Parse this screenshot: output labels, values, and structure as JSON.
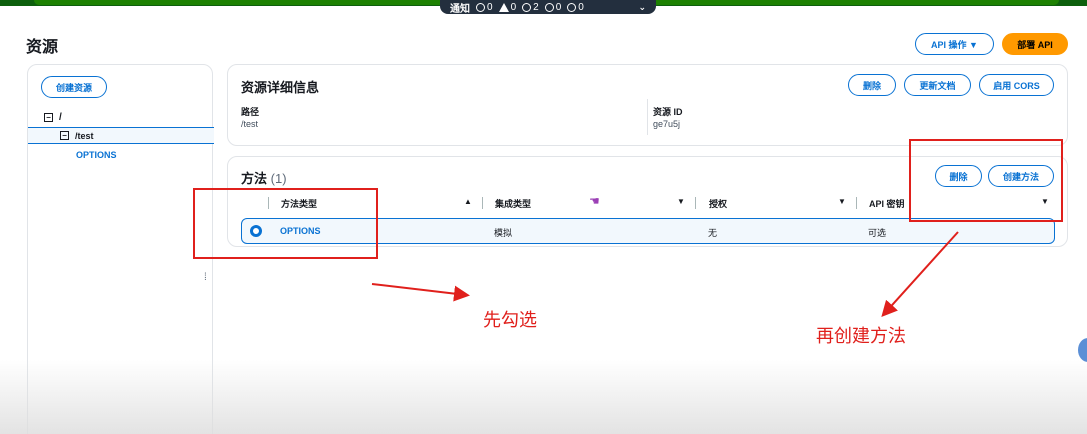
{
  "notifications": {
    "label": "通知",
    "counts": [
      "0",
      "0",
      "2",
      "0",
      "0"
    ],
    "expand_icon": "chevron-down-icon"
  },
  "header": {
    "title": "资源",
    "api_actions_label": "API 操作 ▼",
    "deploy_api_label": "部署 API"
  },
  "sidebar": {
    "create_resource_label": "创建资源",
    "tree": {
      "root": "/",
      "child": "/test",
      "method": "OPTIONS"
    }
  },
  "details": {
    "title": "资源详细信息",
    "delete_label": "删除",
    "update_doc_label": "更新文档",
    "enable_cors_label": "启用 CORS",
    "path_label": "路径",
    "path_value": "/test",
    "resource_id_label": "资源 ID",
    "resource_id_value": "ge7u5j"
  },
  "methods": {
    "title": "方法",
    "count": "(1)",
    "delete_label": "删除",
    "create_method_label": "创建方法",
    "columns": [
      "方法类型",
      "集成类型",
      "授权",
      "API 密钥"
    ],
    "rows": [
      {
        "method_type": "OPTIONS",
        "integration_type": "模拟",
        "authorization": "无",
        "api_key": "可选"
      }
    ]
  },
  "annotations": {
    "select_first": "先勾选",
    "then_create": "再创建方法",
    "color": "#e0201c"
  }
}
